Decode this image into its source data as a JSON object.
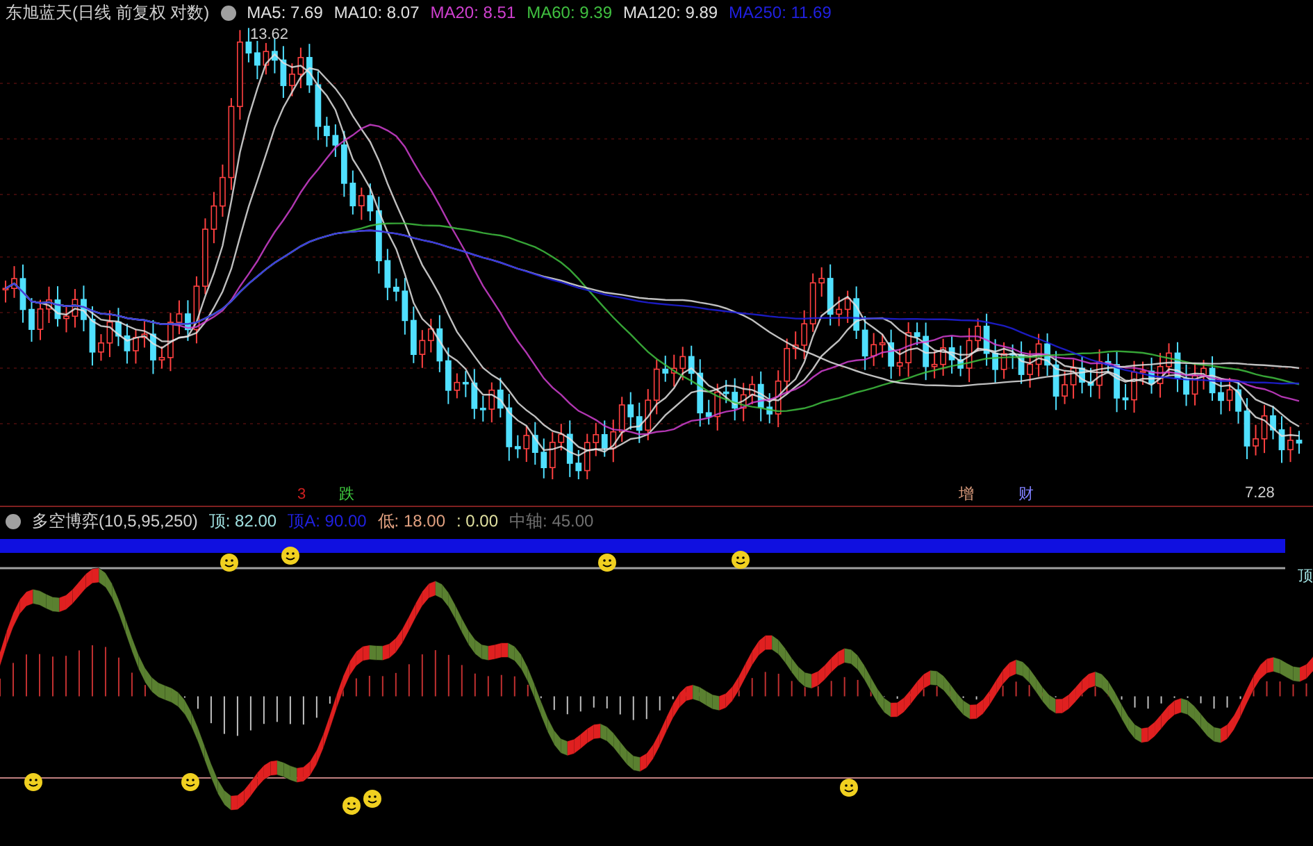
{
  "main_chart": {
    "title": "东旭蓝天(日线 前复权 对数)",
    "ma_legend": [
      {
        "label": "MA5: 7.69",
        "color": "#e0e0e0"
      },
      {
        "label": "MA10: 8.07",
        "color": "#e0e0e0"
      },
      {
        "label": "MA20: 8.51",
        "color": "#d040d0"
      },
      {
        "label": "MA60: 9.39",
        "color": "#40c040"
      },
      {
        "label": "MA120: 9.89",
        "color": "#e0e0e0"
      },
      {
        "label": "MA250: 11.69",
        "color": "#2020e0"
      }
    ],
    "high_label": "13.62",
    "low_label": "7.28",
    "signals": [
      {
        "text": "3",
        "color": "#d02020"
      },
      {
        "text": "跌",
        "color": "#40d040"
      },
      {
        "text": "增",
        "color": "#e0a080"
      },
      {
        "text": "财",
        "color": "#8080ff"
      }
    ]
  },
  "indicator": {
    "title": "多空博弈(10,5,95,250)",
    "legend": [
      {
        "label": "顶: 82.00",
        "color": "#a0e0e0"
      },
      {
        "label": "顶A: 90.00",
        "color": "#2020e0"
      },
      {
        "label": "低: 18.00",
        "color": "#e0a080"
      },
      {
        "label": ": 0.00",
        "color": "#e0e0a0"
      },
      {
        "label": "中轴: 45.00",
        "color": "#707070"
      }
    ],
    "top_marker": "顶"
  }
}
